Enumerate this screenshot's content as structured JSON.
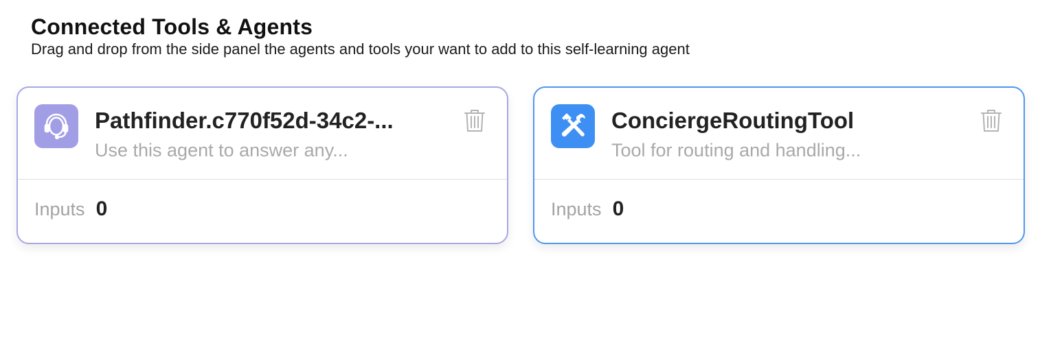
{
  "header": {
    "title": "Connected Tools & Agents",
    "subtitle": "Drag and drop from the side panel the agents and tools your want to add to this self-learning agent"
  },
  "cards": [
    {
      "kind": "agent",
      "icon": "headset-icon",
      "name": "Pathfinder.c770f52d-34c2-...",
      "description": "Use this agent to answer any...",
      "inputs_label": "Inputs",
      "inputs_count": "0",
      "accent": "#a29ee6",
      "border": "#a8a6e6"
    },
    {
      "kind": "tool",
      "icon": "hammer-wrench-icon",
      "name": "ConciergeRoutingTool",
      "description": "Tool for routing and handling...",
      "inputs_label": "Inputs",
      "inputs_count": "0",
      "accent": "#3d8ff3",
      "border": "#4f97ee"
    }
  ],
  "icons": {
    "delete": "trash-icon"
  }
}
